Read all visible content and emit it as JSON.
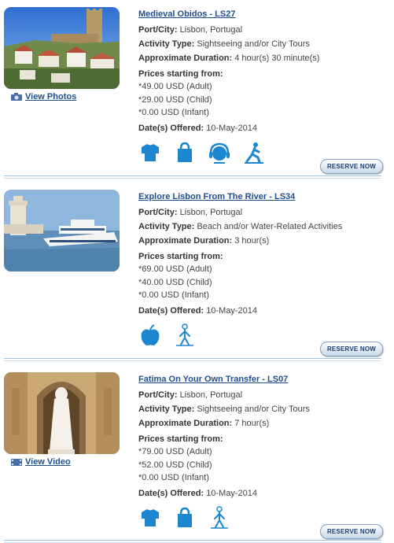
{
  "tours": [
    {
      "title": "Medieval Obidos - LS27",
      "port_label": "Port/City:",
      "port": "Lisbon, Portugal",
      "activity_label": "Activity Type:",
      "activity": "Sightseeing and/or City Tours",
      "duration_label": "Approximate Duration:",
      "duration": "4 hour(s) 30 minute(s)",
      "prices_label": "Prices starting from:",
      "price_adult": "*49.00 USD (Adult)",
      "price_child": "*29.00 USD (Child)",
      "price_infant": "*0.00 USD (Infant)",
      "dates_label": "Date(s) Offered:",
      "dates": "10-May-2014",
      "media_link": "View Photos",
      "reserve": "RESERVE NOW",
      "icons": [
        "clothing-icon",
        "shopping-bag-icon",
        "audio-guide-icon",
        "walking-icon"
      ]
    },
    {
      "title": "Explore Lisbon From The River - LS34",
      "port_label": "Port/City:",
      "port": "Lisbon, Portugal",
      "activity_label": "Activity Type:",
      "activity": "Beach and/or Water-Related Activities",
      "duration_label": "Approximate Duration:",
      "duration": "3 hour(s)",
      "prices_label": "Prices starting from:",
      "price_adult": "*69.00 USD (Adult)",
      "price_child": "*40.00 USD (Child)",
      "price_infant": "*0.00 USD (Infant)",
      "dates_label": "Date(s) Offered:",
      "dates": "10-May-2014",
      "reserve": "RESERVE NOW",
      "icons": [
        "food-apple-icon",
        "easy-walk-icon"
      ]
    },
    {
      "title": "Fatima On Your Own Transfer - LS07",
      "port_label": "Port/City:",
      "port": "Lisbon, Portugal",
      "activity_label": "Activity Type:",
      "activity": "Sightseeing and/or City Tours",
      "duration_label": "Approximate Duration:",
      "duration": "7 hour(s)",
      "prices_label": "Prices starting from:",
      "price_adult": "*79.00 USD (Adult)",
      "price_child": "*52.00 USD (Child)",
      "price_infant": "*0.00 USD (Infant)",
      "dates_label": "Date(s) Offered:",
      "dates": "10-May-2014",
      "media_link": "View Video",
      "reserve": "RESERVE NOW",
      "icons": [
        "clothing-icon",
        "shopping-bag-icon",
        "easy-walk-icon"
      ]
    }
  ],
  "colors": {
    "link": "#1f4f8f",
    "icon_blue": "#1c86d1",
    "separator": "#9fc3e0"
  }
}
